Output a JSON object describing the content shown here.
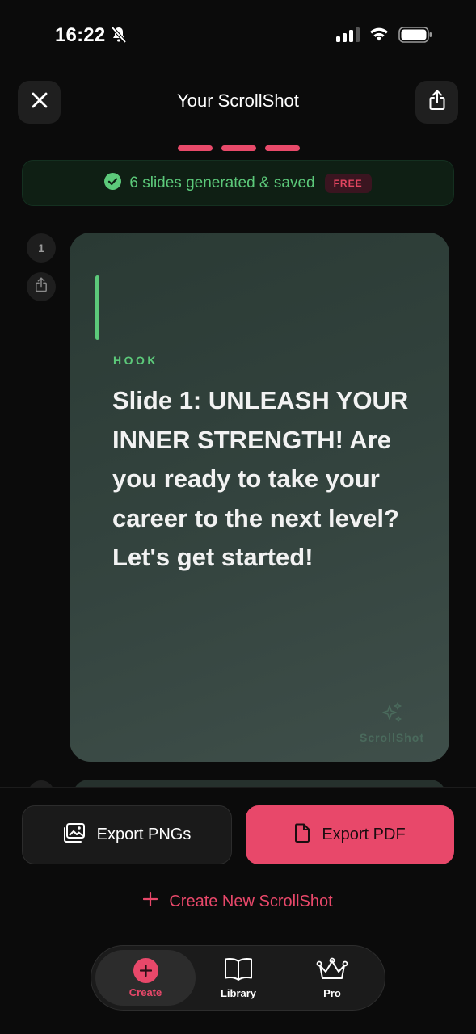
{
  "status_bar": {
    "time": "16:22"
  },
  "header": {
    "title": "Your ScrollShot"
  },
  "progress": {
    "steps_total": 3,
    "steps_active": 3
  },
  "banner": {
    "text": "6 slides generated & saved",
    "badge": "FREE",
    "icon": "check-circle-icon"
  },
  "slides": [
    {
      "number": "1",
      "tag": "HOOK",
      "text": "Slide 1: UNLEASH YOUR INNER STRENGTH! Are you ready to take your career to the next level? Let's get started!",
      "brand": "ScrollShot"
    }
  ],
  "actions": {
    "export_png": "Export PNGs",
    "export_pdf": "Export PDF",
    "create_new": "Create New ScrollShot"
  },
  "tabbar": {
    "items": [
      {
        "label": "Create",
        "icon": "plus-circle-icon",
        "active": true
      },
      {
        "label": "Library",
        "icon": "book-icon",
        "active": false
      },
      {
        "label": "Pro",
        "icon": "crown-icon",
        "active": false
      }
    ]
  },
  "colors": {
    "accent": "#e8486a",
    "success": "#5cc97a",
    "background": "#0b0b0b",
    "slide": "#34443f"
  }
}
